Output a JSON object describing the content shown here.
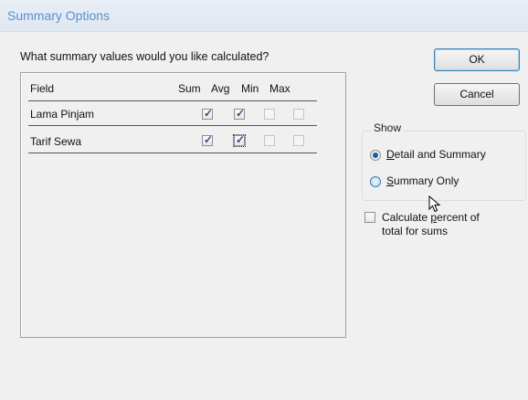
{
  "window": {
    "title": "Summary Options"
  },
  "question": "What summary values would you like calculated?",
  "table": {
    "headers": {
      "field": "Field",
      "sum": "Sum",
      "avg": "Avg",
      "min": "Min",
      "max": "Max"
    },
    "rows": [
      {
        "field": "Lama Pinjam",
        "sum": true,
        "avg": true,
        "min": false,
        "max": false
      },
      {
        "field": "Tarif Sewa",
        "sum": true,
        "avg": true,
        "min": false,
        "max": false
      }
    ]
  },
  "buttons": {
    "ok": "OK",
    "cancel": "Cancel"
  },
  "show": {
    "title": "Show",
    "option1": {
      "mnemonic": "D",
      "rest": "etail and Summary",
      "selected": true
    },
    "option2": {
      "mnemonic": "S",
      "rest": "ummary Only",
      "selected": false
    }
  },
  "percent": {
    "line1_pre": "Calculate ",
    "line1_mnemonic": "p",
    "line1_post": "ercent of",
    "line2": "total for sums",
    "checked": false
  },
  "colors": {
    "title": "#5b8fcc",
    "accent": "#1f5a9f",
    "border": "#a0a0a0"
  }
}
